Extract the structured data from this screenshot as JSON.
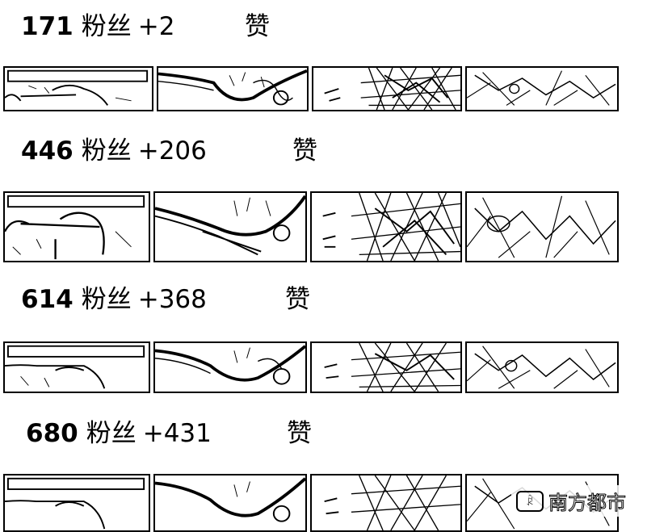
{
  "rows": [
    {
      "count": "171",
      "label": "粉丝",
      "delta": "+2",
      "like": "赞"
    },
    {
      "count": "446",
      "label": "粉丝",
      "delta": "+206",
      "like": "赞"
    },
    {
      "count": "614",
      "label": "粉丝",
      "delta": "+368",
      "like": "赞"
    },
    {
      "count": "680",
      "label": "粉丝",
      "delta": "+431",
      "like": "赞"
    }
  ],
  "thumbnails": [
    {
      "icon": "map-sketch-icon"
    },
    {
      "icon": "river-sketch-icon"
    },
    {
      "icon": "dense-branches-icon"
    },
    {
      "icon": "scattered-branches-icon"
    }
  ],
  "watermark": {
    "icon_text": "ꂯ",
    "text": "南方都市"
  },
  "colors": {
    "ink": "#000000",
    "background": "#ffffff"
  }
}
